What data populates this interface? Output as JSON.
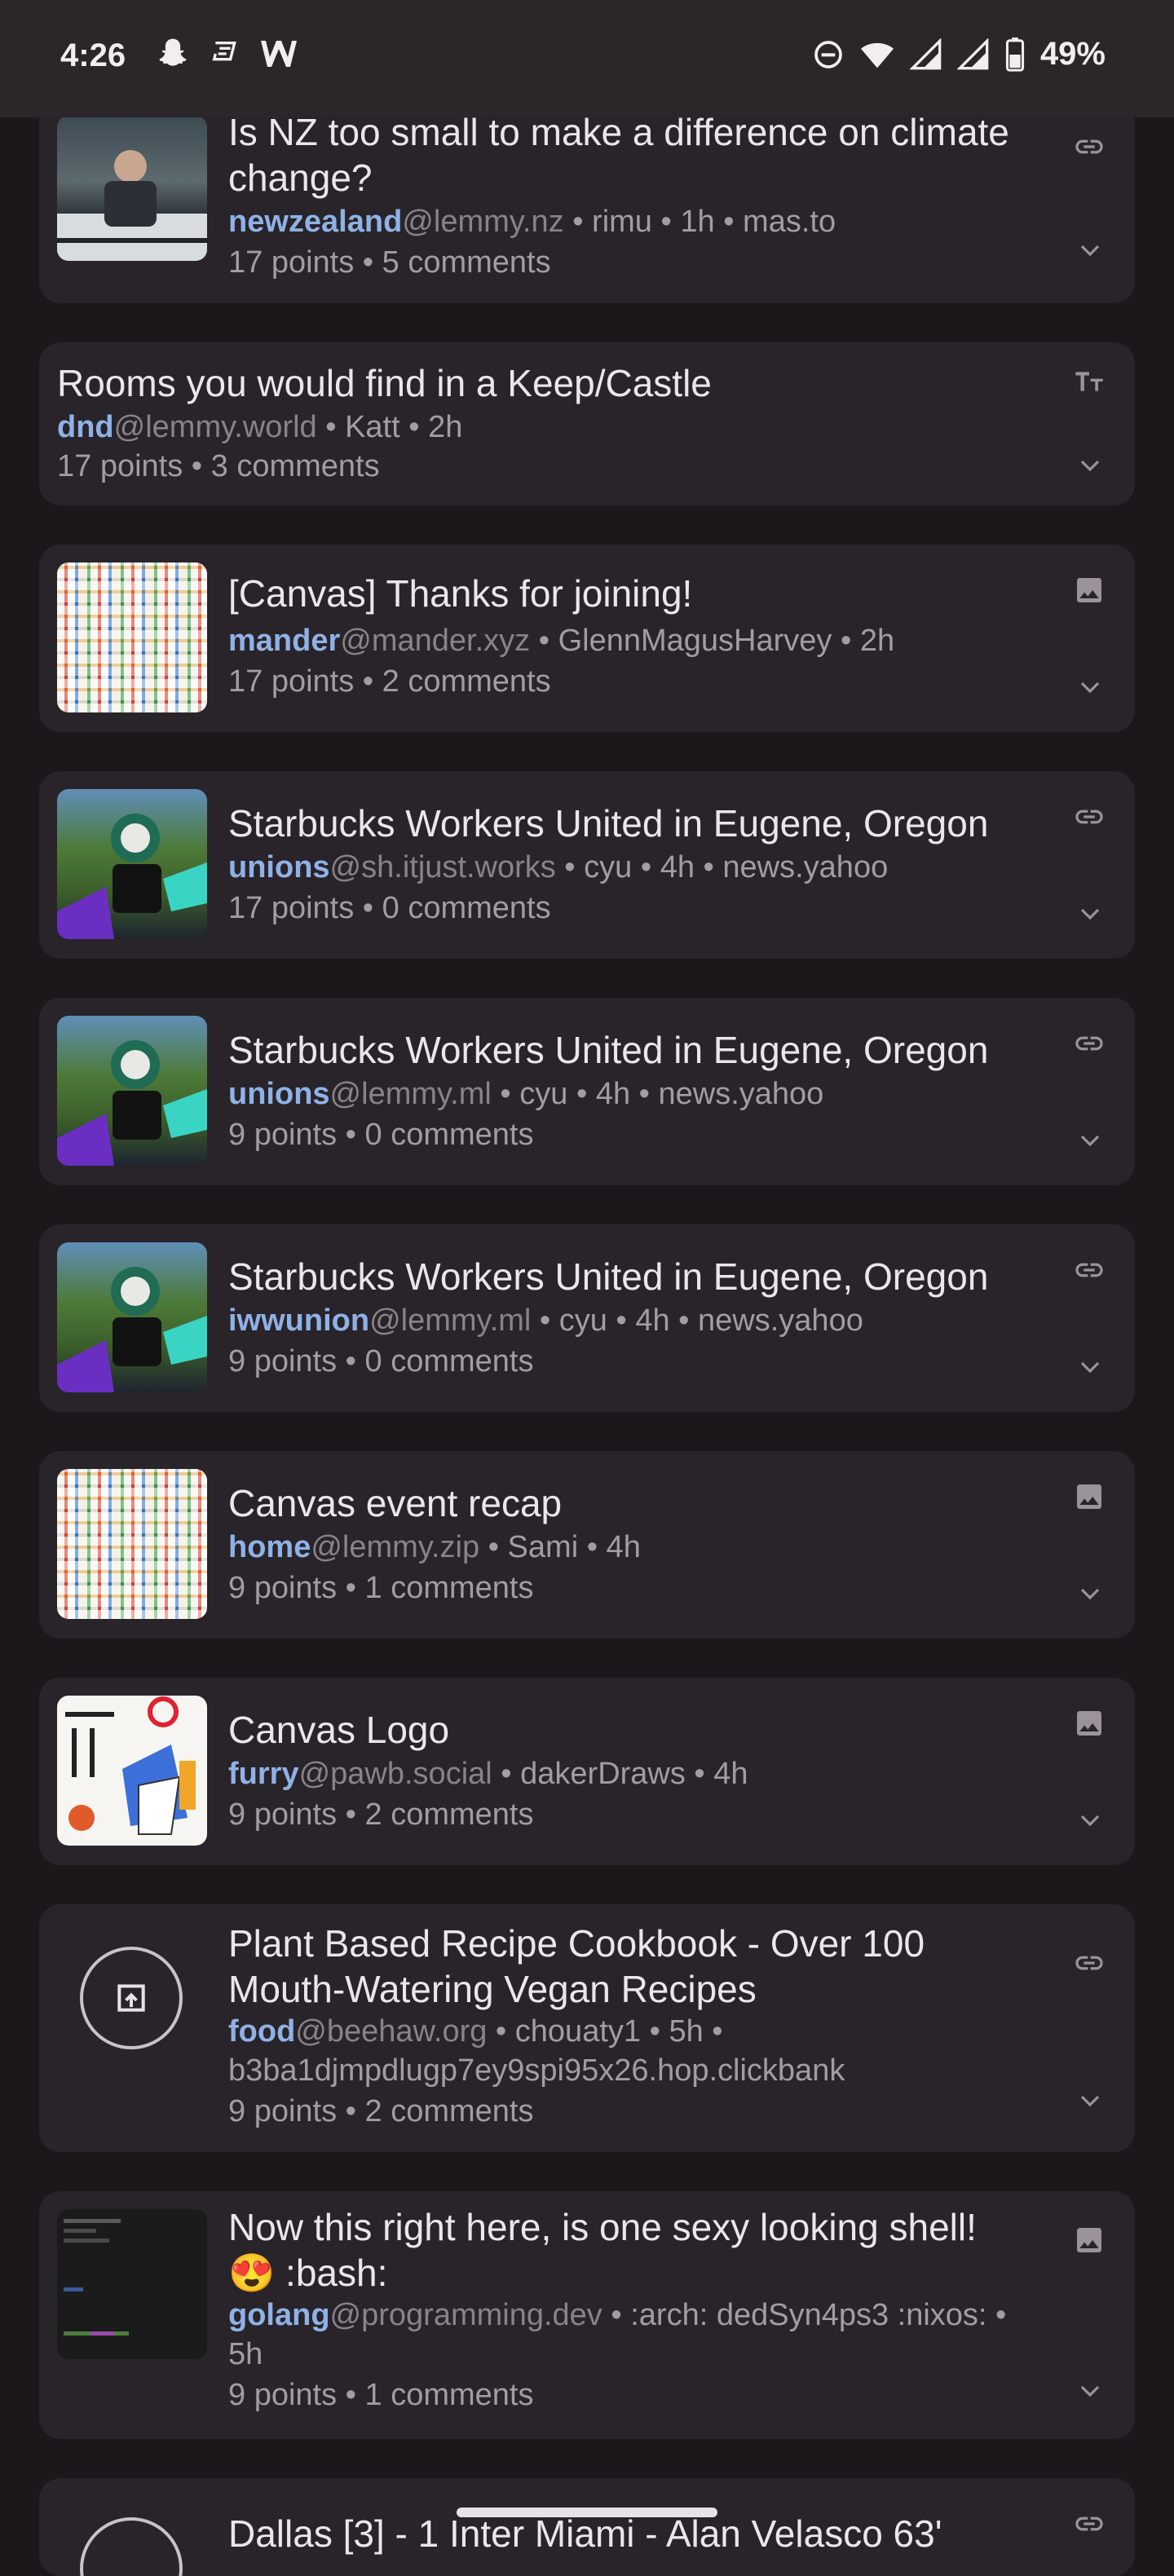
{
  "status_bar": {
    "time": "4:26",
    "battery": "49%"
  },
  "posts": [
    {
      "title": "Is NZ too small to make a difference on climate change?",
      "community": "newzealand",
      "instance": "@lemmy.nz",
      "meta_rest": " • rimu • 1h • mas.to",
      "stats": "17 points • 5 comments",
      "type": "link",
      "thumb": "photo-meeting"
    },
    {
      "title": "Rooms you would find in a Keep/Castle",
      "community": "dnd",
      "instance": "@lemmy.world",
      "meta_rest": " • Katt • 2h",
      "stats": "17 points • 3 comments",
      "type": "text",
      "thumb": "none"
    },
    {
      "title": "[Canvas] Thanks for joining!",
      "community": "mander",
      "instance": "@mander.xyz",
      "meta_rest": " • GlennMagusHarvey • 2h",
      "stats": "17 points • 2 comments",
      "type": "image",
      "thumb": "pixel-canvas"
    },
    {
      "title": "Starbucks Workers United in Eugene, Oregon",
      "community": "unions",
      "instance": "@sh.itjust.works",
      "meta_rest": " • cyu • 4h • news.yahoo",
      "stats": "17 points • 0 comments",
      "type": "link",
      "thumb": "photo-starbucks"
    },
    {
      "title": "Starbucks Workers United in Eugene, Oregon",
      "community": "unions",
      "instance": "@lemmy.ml",
      "meta_rest": " • cyu • 4h • news.yahoo",
      "stats": "9 points • 0 comments",
      "type": "link",
      "thumb": "photo-starbucks"
    },
    {
      "title": "Starbucks Workers United in Eugene, Oregon",
      "community": "iwwunion",
      "instance": "@lemmy.ml",
      "meta_rest": " • cyu • 4h • news.yahoo",
      "stats": "9 points • 0 comments",
      "type": "link",
      "thumb": "photo-starbucks"
    },
    {
      "title": "Canvas event recap",
      "community": "home",
      "instance": "@lemmy.zip",
      "meta_rest": " • Sami • 4h",
      "stats": "9 points • 1 comments",
      "type": "image",
      "thumb": "pixel-canvas"
    },
    {
      "title": "Canvas Logo",
      "community": "furry",
      "instance": "@pawb.social",
      "meta_rest": " • dakerDraws • 4h",
      "stats": "9 points • 2 comments",
      "type": "image",
      "thumb": "pixel-logo"
    },
    {
      "title": "Plant Based Recipe Cookbook - Over 100 Mouth-Watering Vegan Recipes",
      "community": "food",
      "instance": "@beehaw.org",
      "meta_rest": " • chouaty1 • 5h •",
      "meta_line2": "b3ba1djmpdlugp7ey9spi95x26.hop.clickbank",
      "stats": "9 points • 2 comments",
      "type": "link",
      "thumb": "open-link-icon"
    },
    {
      "title_line1": "Now this right here, is one sexy looking shell!",
      "title_line2": "😍 :bash:",
      "community": "golang",
      "instance": "@programming.dev",
      "meta_rest": " • :arch: dedSyn4ps3 :nixos: •",
      "meta_line2": "5h",
      "stats": "9 points • 1 comments",
      "type": "image",
      "thumb": "terminal-screenshot"
    },
    {
      "title": "Dallas [3] - 1 Inter Miami - Alan Velasco 63'",
      "type": "link",
      "thumb": "open-link-icon"
    }
  ],
  "colors": {
    "background": "#1c171b",
    "card": "#29242a",
    "community": "#8fb2e6",
    "meta": "#a49ca2"
  }
}
